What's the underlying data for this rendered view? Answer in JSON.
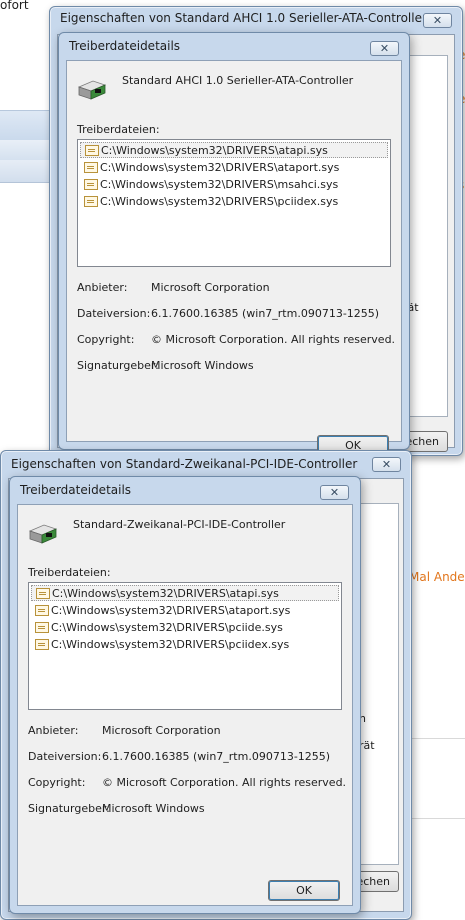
{
  "background": {
    "top_text": "ofort",
    "orange_right_1": "e",
    "orange_right_2": "e",
    "orange_right_3": "s",
    "orange_mid": "Mal Ander",
    "colors": {
      "orange": "#e2761c"
    }
  },
  "window1": {
    "title": "Eigenschaften von Standard AHCI 1.0 Serieller-ATA-Controller",
    "side_text_1": "n",
    "side_text_2": "rät",
    "side_button": "echen"
  },
  "dialog1": {
    "title": "Treiberdateidetails",
    "device_name": "Standard AHCI 1.0 Serieller-ATA-Controller",
    "files_label": "Treiberdateien:",
    "files": [
      "C:\\Windows\\system32\\DRIVERS\\atapi.sys",
      "C:\\Windows\\system32\\DRIVERS\\ataport.sys",
      "C:\\Windows\\system32\\DRIVERS\\msahci.sys",
      "C:\\Windows\\system32\\DRIVERS\\pciidex.sys"
    ],
    "provider_label": "Anbieter:",
    "provider_value": "Microsoft Corporation",
    "version_label": "Dateiversion:",
    "version_value": "6.1.7600.16385 (win7_rtm.090713-1255)",
    "copyright_label": "Copyright:",
    "copyright_value": "© Microsoft Corporation. All rights reserved.",
    "signer_label": "Signaturgeber:",
    "signer_value": "Microsoft Windows",
    "ok_label": "OK"
  },
  "window2": {
    "title": "Eigenschaften von Standard-Zweikanal-PCI-IDE-Controller",
    "side_text_1": "n",
    "side_text_2": "rät",
    "side_button": "echen"
  },
  "dialog2": {
    "title": "Treiberdateidetails",
    "device_name": "Standard-Zweikanal-PCI-IDE-Controller",
    "files_label": "Treiberdateien:",
    "files": [
      "C:\\Windows\\system32\\DRIVERS\\atapi.sys",
      "C:\\Windows\\system32\\DRIVERS\\ataport.sys",
      "C:\\Windows\\system32\\DRIVERS\\pciide.sys",
      "C:\\Windows\\system32\\DRIVERS\\pciidex.sys"
    ],
    "provider_label": "Anbieter:",
    "provider_value": "Microsoft Corporation",
    "version_label": "Dateiversion:",
    "version_value": "6.1.7600.16385 (win7_rtm.090713-1255)",
    "copyright_label": "Copyright:",
    "copyright_value": "© Microsoft Corporation. All rights reserved.",
    "signer_label": "Signaturgeber:",
    "signer_value": "Microsoft Windows",
    "ok_label": "OK"
  }
}
